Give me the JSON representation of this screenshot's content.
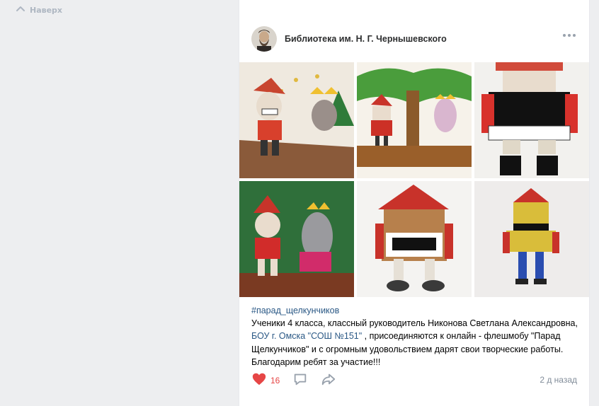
{
  "nav": {
    "back_to_top_label": "Наверх",
    "icon": "chevron-up-icon"
  },
  "post": {
    "author": "Библиотека им. Н. Г. Чернышевского",
    "hashtag": "#парад_щелкунчиков",
    "text_before_link": "Ученики 4 класса, классный руководитель Никонова Светлана Александровна, ",
    "link_text": "БОУ г. Омска \"СОШ №151\"",
    "text_after_link": " , присоединяются к онлайн - флешмобу \"Парад Щелкунчиков\" и с огромным удовольствием дарят свои творческие работы. Благодарим ребят за участие!!!",
    "likes": "16",
    "time": "2 д назад",
    "photos": [
      {
        "name": "photo-nutcracker-mice-kings"
      },
      {
        "name": "photo-nutcracker-tree-mouse"
      },
      {
        "name": "photo-nutcracker-big-face"
      },
      {
        "name": "photo-nutcracker-mouse-king-green"
      },
      {
        "name": "photo-nutcracker-brown-face"
      },
      {
        "name": "photo-nutcracker-yellow-blue"
      }
    ]
  },
  "colors": {
    "link": "#2a5885",
    "like": "#e64646",
    "muted": "#818c99",
    "background": "#edeef0"
  }
}
